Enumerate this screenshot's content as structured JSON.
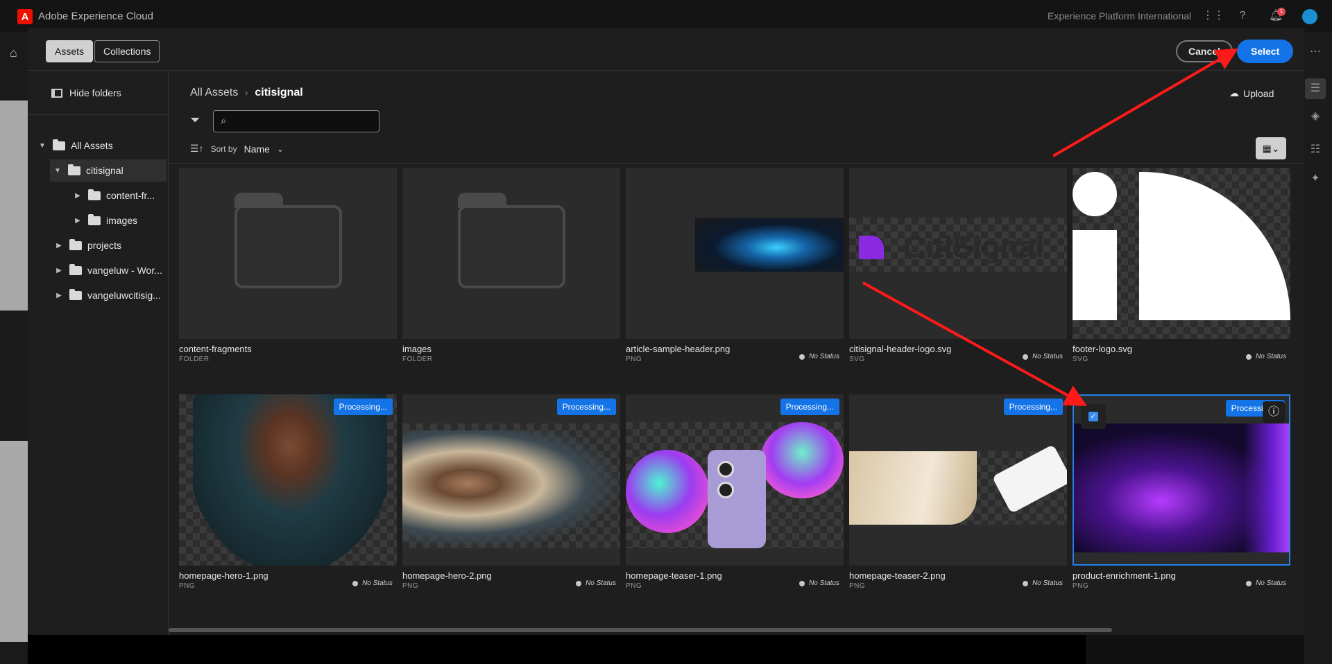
{
  "app": {
    "title": "Adobe Experience Cloud",
    "logo_letter": "A",
    "org": "Experience Platform International",
    "notifications": "1"
  },
  "modal": {
    "tabs": [
      {
        "label": "Assets"
      },
      {
        "label": "Collections"
      }
    ],
    "cancel_label": "Cancel",
    "select_label": "Select"
  },
  "sidebar": {
    "hide_folders": "Hide folders",
    "tree": [
      {
        "label": "All Assets"
      },
      {
        "label": "citisignal"
      },
      {
        "label": "content-fr..."
      },
      {
        "label": "images"
      },
      {
        "label": "projects"
      },
      {
        "label": "vangeluw - Wor..."
      },
      {
        "label": "vangeluwcitisig..."
      }
    ]
  },
  "breadcrumb": {
    "root": "All Assets",
    "current": "citisignal"
  },
  "toolbar": {
    "upload": "Upload",
    "search_placeholder": "",
    "sort_by": "Sort by",
    "sort_field": "Name"
  },
  "assets": [
    {
      "title": "content-fragments",
      "type": "FOLDER",
      "status": "",
      "badge": ""
    },
    {
      "title": "images",
      "type": "FOLDER",
      "status": "",
      "badge": ""
    },
    {
      "title": "article-sample-header.png",
      "type": "PNG",
      "status": "No Status",
      "badge": ""
    },
    {
      "title": "citisignal-header-logo.svg",
      "type": "SVG",
      "status": "No Status",
      "badge": "",
      "logo_text": "CitiSignal"
    },
    {
      "title": "footer-logo.svg",
      "type": "SVG",
      "status": "No Status",
      "badge": ""
    },
    {
      "title": "homepage-hero-1.png",
      "type": "PNG",
      "status": "No Status",
      "badge": "Processing..."
    },
    {
      "title": "homepage-hero-2.png",
      "type": "PNG",
      "status": "No Status",
      "badge": "Processing..."
    },
    {
      "title": "homepage-teaser-1.png",
      "type": "PNG",
      "status": "No Status",
      "badge": "Processing..."
    },
    {
      "title": "homepage-teaser-2.png",
      "type": "PNG",
      "status": "No Status",
      "badge": "Processing..."
    },
    {
      "title": "product-enrichment-1.png",
      "type": "PNG",
      "status": "No Status",
      "badge": "Processing...",
      "selected": true
    }
  ],
  "colors": {
    "accent": "#1473e6",
    "annotation_arrow": "#ff1a1a"
  }
}
